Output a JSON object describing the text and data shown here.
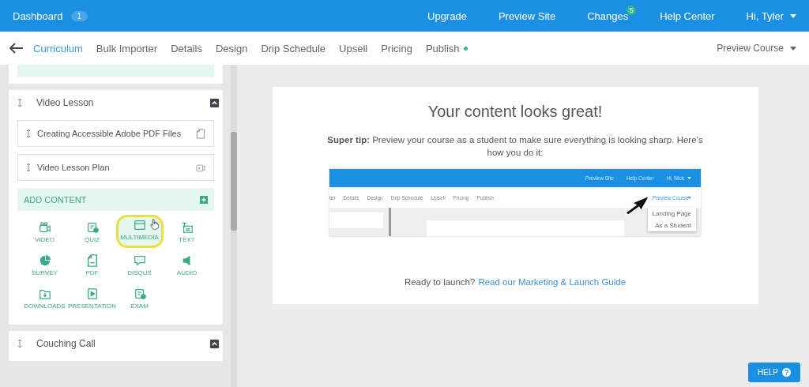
{
  "topbar": {
    "dashboard": "Dashboard",
    "dashboard_count": "1",
    "links": [
      {
        "label": "Upgrade"
      },
      {
        "label": "Preview Site"
      },
      {
        "label": "Changes",
        "badge": "5"
      },
      {
        "label": "Help Center"
      }
    ],
    "user": "Hi, Tyler"
  },
  "tabs": [
    {
      "label": "Curriculum",
      "selected": true,
      "dot": false
    },
    {
      "label": "Bulk Importer",
      "selected": false,
      "dot": false
    },
    {
      "label": "Details",
      "selected": false,
      "dot": false
    },
    {
      "label": "Design",
      "selected": false,
      "dot": false
    },
    {
      "label": "Drip Schedule",
      "selected": false,
      "dot": false
    },
    {
      "label": "Upsell",
      "selected": false,
      "dot": false
    },
    {
      "label": "Pricing",
      "selected": false,
      "dot": false
    },
    {
      "label": "Publish",
      "selected": false,
      "dot": true
    }
  ],
  "preview_course": "Preview Course",
  "chapters": [
    {
      "title": "Video Lesson",
      "expanded": true,
      "lessons": [
        {
          "title": "Creating Accessible Adobe PDF Files",
          "kind": "pdf"
        },
        {
          "title": "Video Lesson Plan",
          "kind": "video"
        }
      ],
      "add_content": "ADD CONTENT",
      "content_types": [
        {
          "label": "VIDEO",
          "kind": "video",
          "selected": false
        },
        {
          "label": "QUIZ",
          "kind": "quiz",
          "selected": false
        },
        {
          "label": "MULTIMEDIA",
          "kind": "multimedia",
          "selected": true
        },
        {
          "label": "TEXT",
          "kind": "text",
          "selected": false
        },
        {
          "label": "SURVEY",
          "kind": "survey",
          "selected": false
        },
        {
          "label": "PDF",
          "kind": "pdf",
          "selected": false
        },
        {
          "label": "DISQUS",
          "kind": "disqus",
          "selected": false
        },
        {
          "label": "AUDIO",
          "kind": "audio",
          "selected": false
        },
        {
          "label": "DOWNLOADS",
          "kind": "downloads",
          "selected": false
        },
        {
          "label": "PRESENTATION",
          "kind": "presentation",
          "selected": false
        },
        {
          "label": "EXAM",
          "kind": "exam",
          "selected": false
        }
      ]
    },
    {
      "title": "Couching Call",
      "expanded": true
    }
  ],
  "main": {
    "title": "Your content looks great!",
    "tip": "**Super tip:** Preview your course as a student to make sure everything is looking sharp. Here’s how you do it:",
    "screenshot": {
      "links": [
        "Preview Site",
        "Help Center",
        "Hi, Nick"
      ],
      "tabs": [
        "ter",
        "Details",
        "Design",
        "Drip Schedule",
        "Upsell",
        "Pricing",
        "Publish"
      ],
      "preview_course": "Preview Course",
      "menu": [
        "Landing Page",
        "As a Student"
      ]
    },
    "ready": "Ready to launch?",
    "guide_link": "Read our Marketing & Launch Guide"
  },
  "help_button": "HELP"
}
